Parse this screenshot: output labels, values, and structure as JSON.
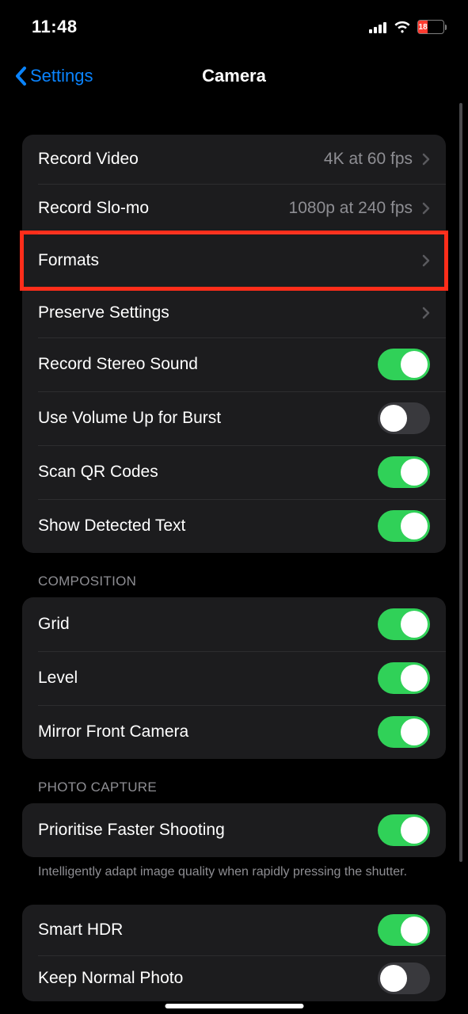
{
  "status": {
    "time": "11:48",
    "battery_pct": "18"
  },
  "nav": {
    "back": "Settings",
    "title": "Camera"
  },
  "sections": {
    "main": {
      "record_video": {
        "label": "Record Video",
        "value": "4K at 60 fps"
      },
      "record_slomo": {
        "label": "Record Slo-mo",
        "value": "1080p at 240 fps"
      },
      "formats": {
        "label": "Formats"
      },
      "preserve": {
        "label": "Preserve Settings"
      },
      "stereo": {
        "label": "Record Stereo Sound",
        "on": true
      },
      "volume_burst": {
        "label": "Use Volume Up for Burst",
        "on": false
      },
      "qr": {
        "label": "Scan QR Codes",
        "on": true
      },
      "detected_text": {
        "label": "Show Detected Text",
        "on": true
      }
    },
    "composition": {
      "header": "Composition",
      "grid": {
        "label": "Grid",
        "on": true
      },
      "level": {
        "label": "Level",
        "on": true
      },
      "mirror": {
        "label": "Mirror Front Camera",
        "on": true
      }
    },
    "photo_capture": {
      "header": "Photo Capture",
      "prioritise": {
        "label": "Prioritise Faster Shooting",
        "on": true
      },
      "prioritise_footer": "Intelligently adapt image quality when rapidly pressing the shutter.",
      "smart_hdr": {
        "label": "Smart HDR",
        "on": true
      },
      "keep_normal": {
        "label": "Keep Normal Photo",
        "on": false
      }
    }
  }
}
